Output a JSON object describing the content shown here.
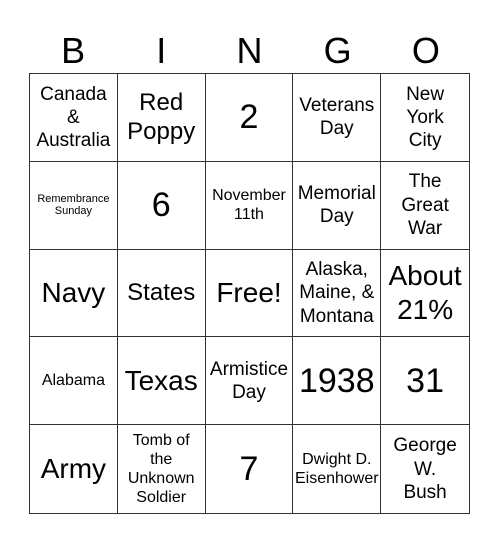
{
  "header": {
    "letters": [
      "B",
      "I",
      "N",
      "G",
      "O"
    ]
  },
  "cells": [
    [
      "Canada\n&\nAustralia",
      "Red\nPoppy",
      "2",
      "Veterans\nDay",
      "New\nYork\nCity"
    ],
    [
      "Remembrance\nSunday",
      "6",
      "November\n11th",
      "Memorial\nDay",
      "The\nGreat\nWar"
    ],
    [
      "Navy",
      "States",
      "Free!",
      "Alaska,\nMaine, &\nMontana",
      "About\n21%"
    ],
    [
      "Alabama",
      "Texas",
      "Armistice\nDay",
      "1938",
      "31"
    ],
    [
      "Army",
      "Tomb of\nthe\nUnknown\nSoldier",
      "7",
      "Dwight D.\nEisenhower",
      "George\nW.\nBush"
    ]
  ],
  "sizes": [
    [
      "s-md",
      "s-lg",
      "s-xxl",
      "s-md",
      "s-md"
    ],
    [
      "s-xs",
      "s-xxl",
      "s-sm",
      "s-md",
      "s-md"
    ],
    [
      "s-xl",
      "s-lg",
      "s-xl",
      "s-md",
      "s-xl"
    ],
    [
      "s-sm",
      "s-xl",
      "s-md",
      "s-xxl",
      "s-xxl"
    ],
    [
      "s-xl",
      "s-sm",
      "s-xxl",
      "s-sm",
      "s-md"
    ]
  ]
}
